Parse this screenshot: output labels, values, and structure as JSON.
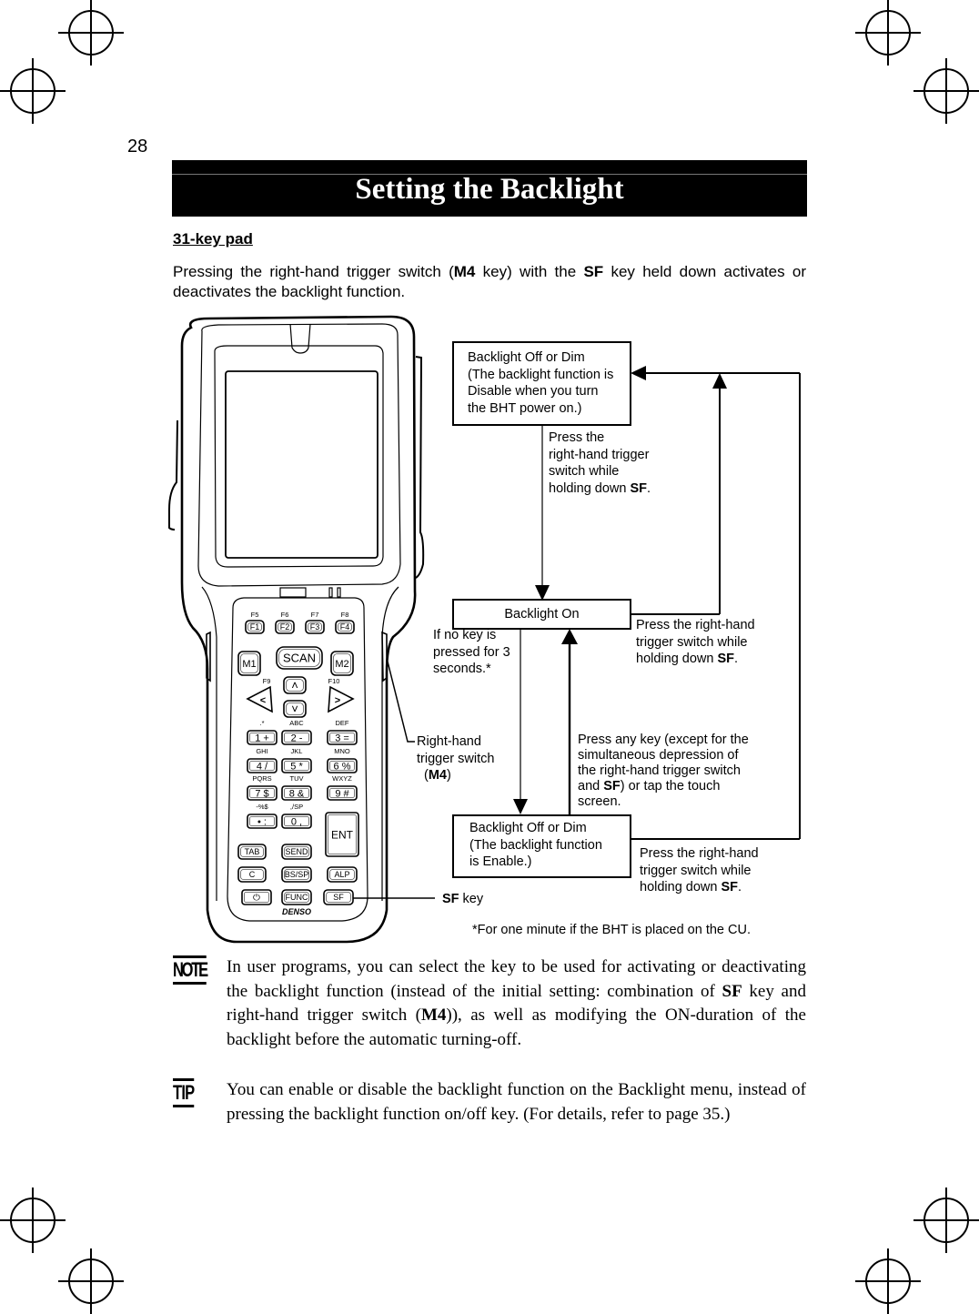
{
  "page": {
    "number": "28",
    "title": "Setting the Backlight",
    "section_heading": "31-key pad",
    "intro": {
      "p1": "Pressing the right-hand trigger switch (",
      "b1": "M4",
      "p2": " key) with the ",
      "b2": "SF",
      "p3": " key held down activates or deactivates the backlight function."
    }
  },
  "diagram": {
    "state_disabled": {
      "line1": "Backlight Off or Dim",
      "line2": "(The backlight function is",
      "line3": "Disable when you turn",
      "line4": "the BHT power on.)"
    },
    "state_on": {
      "label": "Backlight On"
    },
    "state_enabled_off": {
      "line1": "Backlight Off or Dim",
      "line2": "(The backlight function",
      "line3": "is Enable.)"
    },
    "transitions": {
      "disabled_to_on": [
        "Press the",
        "right-hand trigger",
        "switch while",
        "holding down "
      ],
      "on_to_disabled": [
        "Press the right-hand",
        "trigger switch while",
        "holding down "
      ],
      "enabled_to_disabled": [
        "Press the right-hand",
        "trigger switch while",
        "holding down "
      ],
      "timeout": [
        "If no key is",
        "pressed for 3",
        "seconds.*"
      ],
      "any_key": [
        "Press any key (except for the",
        "simultaneous depression of",
        "the right-hand trigger switch",
        "and ",
        ") or tap the touch",
        "screen."
      ],
      "sf": "SF",
      "period": "."
    },
    "callouts": {
      "trigger_line1": "Right-hand",
      "trigger_line2": "trigger switch",
      "trigger_open": "(",
      "trigger_key": "M4",
      "trigger_close": ")",
      "sf_key_bold": "SF",
      "sf_key_rest": " key"
    },
    "footnote": "*For one minute if the BHT is placed on the CU."
  },
  "device": {
    "brand": "DENSO",
    "fn_top": [
      "F5",
      "F6",
      "F7",
      "F8"
    ],
    "fn_keys": [
      "F1",
      "F2",
      "F3",
      "F4"
    ],
    "m1": "M1",
    "scan": "SCAN",
    "m2": "M2",
    "f9": "F9",
    "f10": "F10",
    "num_rows": [
      [
        {
          "top": ".*",
          "k": "1 +"
        },
        {
          "top": "ABC",
          "k": "2 -"
        },
        {
          "top": "DEF",
          "k": "3 ="
        }
      ],
      [
        {
          "top": "GHI",
          "k": "4 /"
        },
        {
          "top": "JKL",
          "k": "5 *"
        },
        {
          "top": "MNO",
          "k": "6 %"
        }
      ],
      [
        {
          "top": "PQRS",
          "k": "7 $"
        },
        {
          "top": "TUV",
          "k": "8 &"
        },
        {
          "top": "WXYZ",
          "k": "9 #"
        }
      ],
      [
        {
          "top": "-%$",
          "k": "• :"
        },
        {
          "top": ",/SP",
          "k": "0 ,"
        }
      ]
    ],
    "ent": "ENT",
    "row_tab": [
      "TAB",
      "SEND"
    ],
    "row_c": [
      "C",
      "BS/SP",
      "ALP"
    ],
    "row_func": [
      "⏻",
      "FUNC",
      "SF"
    ]
  },
  "note": {
    "icon": "NOTE",
    "t1": "In user programs, you can select the key to be used for activating or deactivating the backlight function (instead of the initial setting: combination of ",
    "b1": "SF",
    "t2": " key and right-hand trigger switch (",
    "b2": "M4",
    "t3": ")), as well as modifying the ON-duration of the backlight before the automatic turning-off."
  },
  "tip": {
    "icon": "TIP",
    "text": "You can enable or disable the backlight function on the Backlight menu, instead of pressing the backlight function on/off key. (For details, refer to page 35.)"
  }
}
